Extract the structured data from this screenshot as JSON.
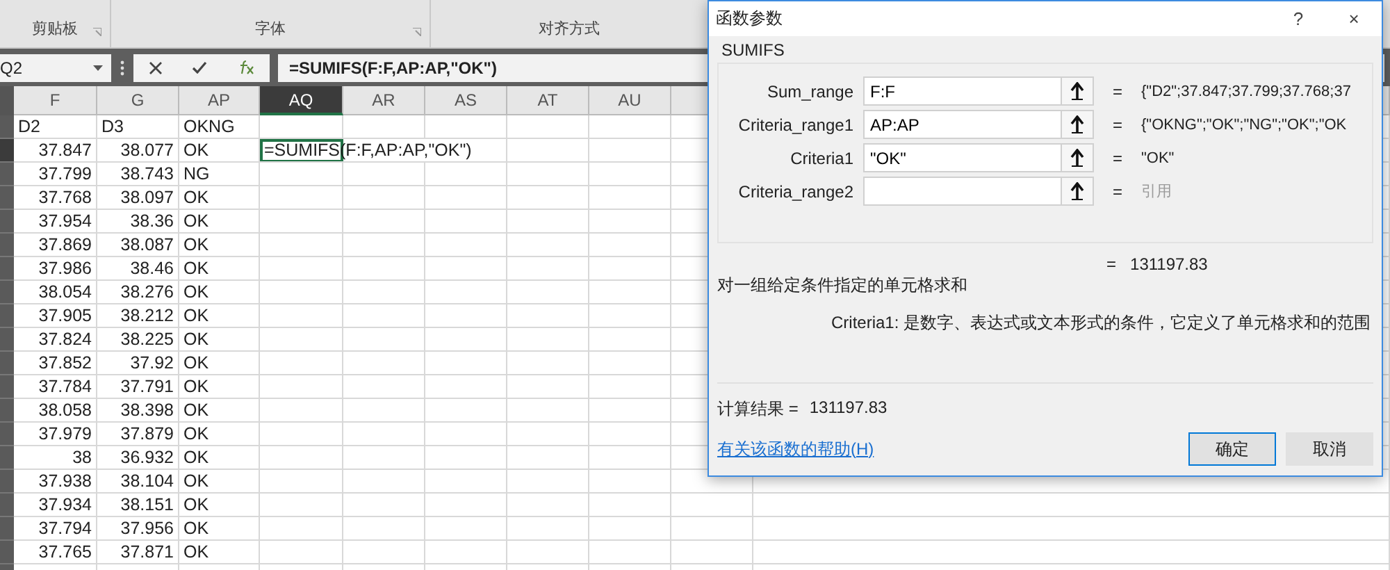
{
  "ribbon": {
    "groups": [
      {
        "label": "剪贴板",
        "launcher": true
      },
      {
        "label": "字体",
        "launcher": true
      },
      {
        "label": "对齐方式",
        "launcher": false
      }
    ]
  },
  "formula_bar": {
    "name_box": "Q2",
    "formula": "=SUMIFS(F:F,AP:AP,\"OK\")"
  },
  "sheet": {
    "columns": [
      {
        "label": "F",
        "kind": "number",
        "selected": false
      },
      {
        "label": "G",
        "kind": "number",
        "selected": false
      },
      {
        "label": "AP",
        "kind": "text",
        "selected": false
      },
      {
        "label": "AQ",
        "selected": true
      },
      {
        "label": "AR",
        "selected": false
      },
      {
        "label": "AS",
        "selected": false
      },
      {
        "label": "AT",
        "selected": false
      },
      {
        "label": "AU",
        "selected": false
      }
    ],
    "rows": [
      {
        "kind": "header",
        "selected": false,
        "cells": [
          "D2",
          "D3",
          "OKNG"
        ]
      },
      {
        "kind": "data",
        "selected": true,
        "cells": [
          "37.847",
          "38.077",
          "OK",
          "=SUMIFS(F:F,AP:AP,\"OK\")"
        ]
      },
      {
        "kind": "data",
        "selected": false,
        "cells": [
          "37.799",
          "38.743",
          "NG"
        ]
      },
      {
        "kind": "data",
        "selected": false,
        "cells": [
          "37.768",
          "38.097",
          "OK"
        ]
      },
      {
        "kind": "data",
        "selected": false,
        "cells": [
          "37.954",
          "38.36",
          "OK"
        ]
      },
      {
        "kind": "data",
        "selected": false,
        "cells": [
          "37.869",
          "38.087",
          "OK"
        ]
      },
      {
        "kind": "data",
        "selected": false,
        "cells": [
          "37.986",
          "38.46",
          "OK"
        ]
      },
      {
        "kind": "data",
        "selected": false,
        "cells": [
          "38.054",
          "38.276",
          "OK"
        ]
      },
      {
        "kind": "data",
        "selected": false,
        "cells": [
          "37.905",
          "38.212",
          "OK"
        ]
      },
      {
        "kind": "data",
        "selected": false,
        "cells": [
          "37.824",
          "38.225",
          "OK"
        ]
      },
      {
        "kind": "data",
        "selected": false,
        "cells": [
          "37.852",
          "37.92",
          "OK"
        ]
      },
      {
        "kind": "data",
        "selected": false,
        "cells": [
          "37.784",
          "37.791",
          "OK"
        ]
      },
      {
        "kind": "data",
        "selected": false,
        "cells": [
          "38.058",
          "38.398",
          "OK"
        ]
      },
      {
        "kind": "data",
        "selected": false,
        "cells": [
          "37.979",
          "37.879",
          "OK"
        ]
      },
      {
        "kind": "data",
        "selected": false,
        "cells": [
          "38",
          "36.932",
          "OK"
        ]
      },
      {
        "kind": "data",
        "selected": false,
        "cells": [
          "37.938",
          "38.104",
          "OK"
        ]
      },
      {
        "kind": "data",
        "selected": false,
        "cells": [
          "37.934",
          "38.151",
          "OK"
        ]
      },
      {
        "kind": "data",
        "selected": false,
        "cells": [
          "37.794",
          "37.956",
          "OK"
        ]
      },
      {
        "kind": "data",
        "selected": false,
        "cells": [
          "37.765",
          "37.871",
          "OK"
        ]
      }
    ]
  },
  "dialog": {
    "title": "函数参数",
    "help": "?",
    "close": "×",
    "function": "SUMIFS",
    "arguments": [
      {
        "label": "Sum_range",
        "value": "F:F",
        "result": "{\"D2\";37.847;37.799;37.768;37",
        "muted": false
      },
      {
        "label": "Criteria_range1",
        "value": "AP:AP",
        "result": "{\"OKNG\";\"OK\";\"NG\";\"OK\";\"OK",
        "muted": false
      },
      {
        "label": "Criteria1",
        "value": "\"OK\"",
        "result": "\"OK\"",
        "muted": false
      },
      {
        "label": "Criteria_range2",
        "result": "引用",
        "muted": true
      }
    ],
    "equals": "=",
    "total": "131197.83",
    "description": "对一组给定条件指定的单元格求和",
    "argument_help": "Criteria1:  是数字、表达式或文本形式的条件，它定义了单元格求和的范围",
    "result_label": "计算结果 =",
    "result": "131197.83",
    "help_link": "有关该函数的帮助(H)",
    "buttons": [
      {
        "label": "确定",
        "selected": true
      },
      {
        "label": "取消",
        "selected": false
      }
    ]
  }
}
